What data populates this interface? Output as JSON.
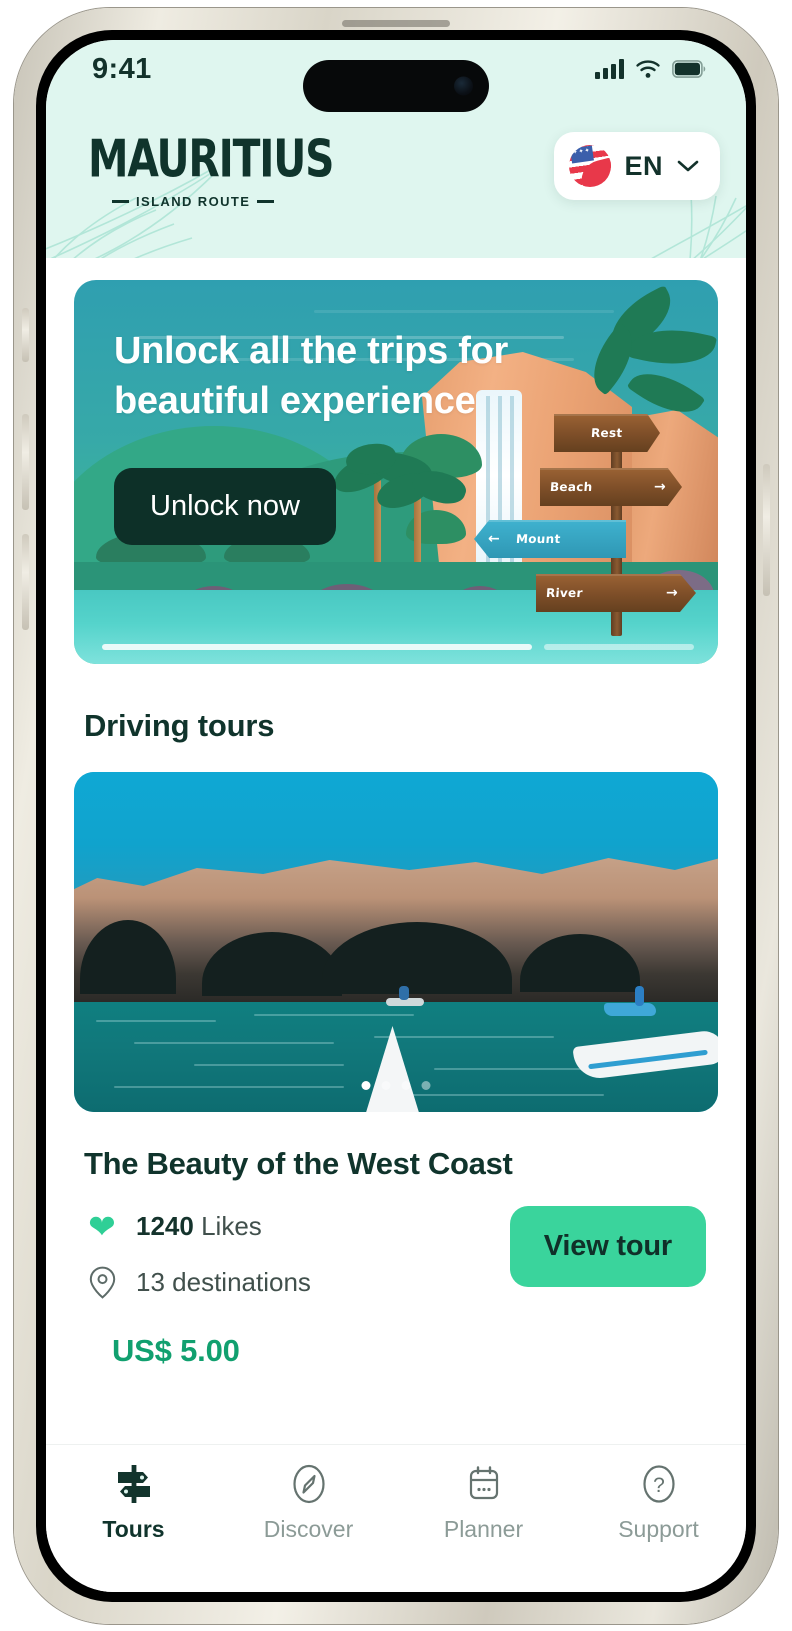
{
  "status_bar": {
    "time": "9:41",
    "icons": [
      "cellular-signal-icon",
      "wifi-icon",
      "battery-icon"
    ]
  },
  "header": {
    "logo_word": "MAURITIUS",
    "logo_tagline": "ISLAND ROUTE",
    "language": {
      "flag": "us-flag-icon",
      "label": "EN",
      "chevron": "chevron-down-icon"
    }
  },
  "promo_banner": {
    "headline": "Unlock all the trips for beautiful experience",
    "cta_label": "Unlock now",
    "signposts": [
      {
        "label": "Rest",
        "arrow": "",
        "style": "wood"
      },
      {
        "label": "Beach",
        "arrow": "→",
        "style": "wood"
      },
      {
        "label": "Mount",
        "arrow": "←",
        "style": "teal"
      },
      {
        "label": "River",
        "arrow": "→",
        "style": "wood"
      }
    ]
  },
  "section": {
    "title": "Driving tours"
  },
  "tour_card": {
    "photo_alt": "sea-cave-kayak-photo",
    "carousel": {
      "total": 4,
      "active_index": 0
    },
    "name": "The Beauty of the West Coast",
    "likes_count": "1240",
    "likes_label": "Likes",
    "destinations": "13 destinations",
    "view_button_label": "View tour",
    "price": "US$ 5.00"
  },
  "bottom_nav": {
    "items": [
      {
        "label": "Tours",
        "icon": "signpost-icon",
        "active": true
      },
      {
        "label": "Discover",
        "icon": "compass-icon",
        "active": false
      },
      {
        "label": "Planner",
        "icon": "calendar-icon",
        "active": false
      },
      {
        "label": "Support",
        "icon": "help-circle-icon",
        "active": false
      }
    ]
  },
  "colors": {
    "mint_bg": "#dff6ef",
    "dark_green": "#10342c",
    "accent_green": "#3ad49c",
    "price_green": "#11a06f",
    "heart_green": "#2fcf96",
    "muted_text": "#8c9b97"
  }
}
